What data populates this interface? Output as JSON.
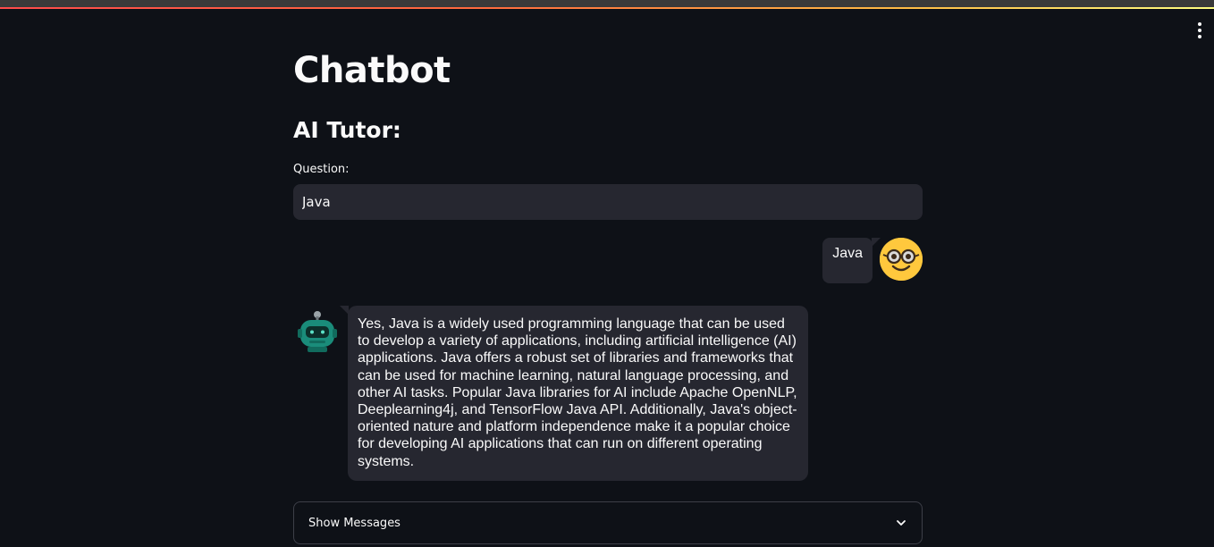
{
  "app": {
    "title": "Chatbot",
    "subheader": "AI Tutor:"
  },
  "input": {
    "label": "Question:",
    "value": "Java"
  },
  "chat": {
    "user_message": "Java",
    "bot_message": "Yes, Java is a widely used programming language that can be used to develop a variety of applications, including artificial intelligence (AI) applications. Java offers a robust set of libraries and frameworks that can be used for machine learning, natural language processing, and other AI tasks. Popular Java libraries for AI include Apache OpenNLP, Deeplearning4j, and TensorFlow Java API. Additionally, Java's object-oriented nature and platform independence make it a popular choice for developing AI applications that can run on different operating systems.",
    "user_avatar_icon": "nerd-face-icon",
    "bot_avatar_icon": "robot-icon"
  },
  "expander": {
    "label": "Show Messages",
    "icon": "chevron-down-icon"
  },
  "colors": {
    "background": "#0e1117",
    "bubble": "#262730",
    "user_avatar": "#ffc83d",
    "bot_avatar": "#1a8c7a"
  }
}
